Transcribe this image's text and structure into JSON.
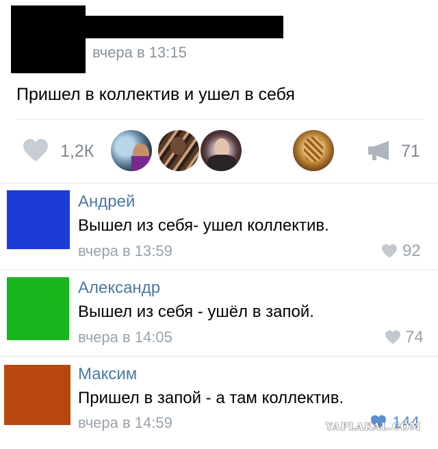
{
  "post": {
    "time": "вчера в 13:15",
    "text": "Пришел в коллектив и ушел в себя",
    "likes": "1,2К",
    "shares": "71"
  },
  "comments": [
    {
      "author": "Андрей",
      "text": "Вышел из себя- ушел коллектив.",
      "time": "вчера в 13:59",
      "likes": "92",
      "avatar_color": "#1b3cd6"
    },
    {
      "author": "Александр",
      "text": "Вышел из себя - ушёл в запой.",
      "time": "вчера в 14:05",
      "likes": "74",
      "avatar_color": "#17b51e"
    },
    {
      "author": "Максим",
      "text": "Пришел в запой - а там коллектив.",
      "time": "вчера в 14:59",
      "likes": "144",
      "avatar_color": "#b8470f"
    }
  ],
  "watermark": "YAPLAKAL.COM",
  "colors": {
    "link": "#4b78a5",
    "muted": "#99a2ab",
    "divider": "#e3e6e9"
  }
}
